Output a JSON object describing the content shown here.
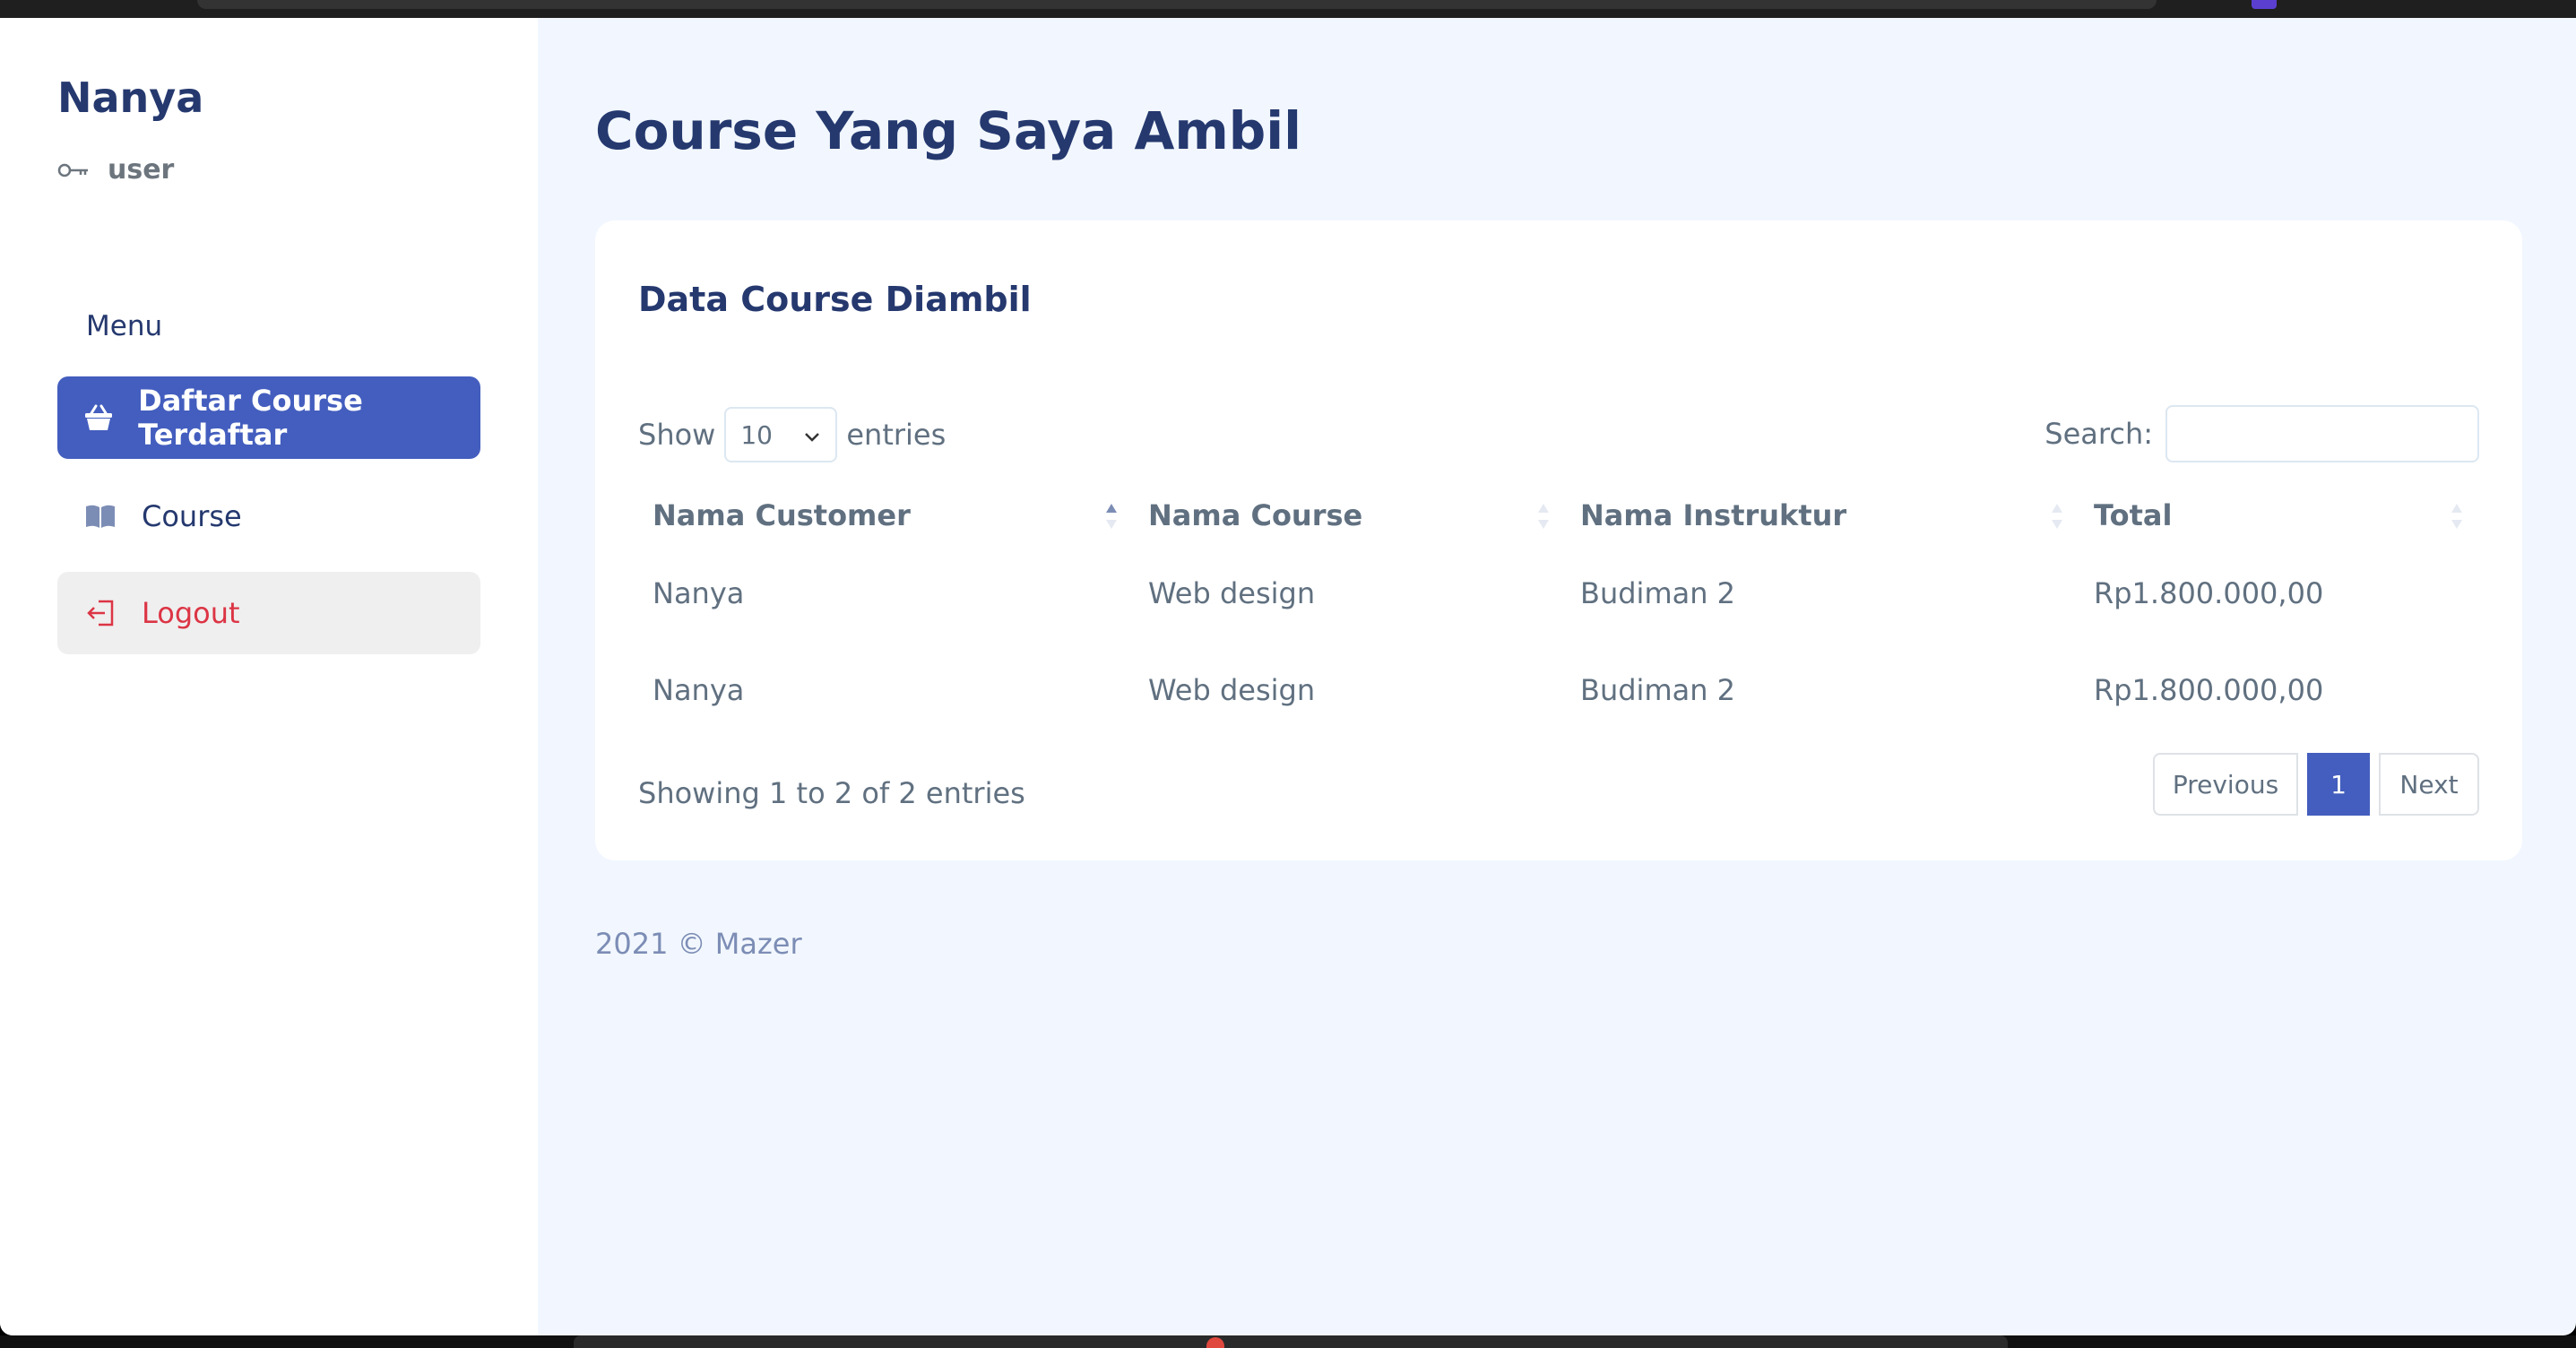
{
  "sidebar": {
    "brand": "Nanya",
    "role": "user",
    "role_icon": "key-icon",
    "menu_title": "Menu",
    "items": [
      {
        "label": "Daftar Course Terdaftar",
        "icon": "basket-icon",
        "active": true
      },
      {
        "label": "Course",
        "icon": "book-icon",
        "active": false
      },
      {
        "label": "Logout",
        "icon": "logout-icon",
        "active": false
      }
    ]
  },
  "page": {
    "title": "Course Yang Saya Ambil"
  },
  "card": {
    "title": "Data Course Diambil",
    "length_prefix": "Show",
    "length_value": "10",
    "length_suffix": "entries",
    "search_label": "Search:",
    "search_value": "",
    "columns": [
      "Nama Customer",
      "Nama Course",
      "Nama Instruktur",
      "Total"
    ],
    "rows": [
      [
        "Nanya",
        "Web design",
        "Budiman 2",
        "Rp1.800.000,00"
      ],
      [
        "Nanya",
        "Web design",
        "Budiman 2",
        "Rp1.800.000,00"
      ]
    ],
    "info": "Showing 1 to 2 of 2 entries",
    "pagination": {
      "previous": "Previous",
      "current": "1",
      "next": "Next"
    }
  },
  "footer": "2021 © Mazer",
  "colors": {
    "primary": "#435ebe",
    "heading": "#25396f",
    "danger": "#dc3545",
    "background": "#f2f7ff"
  }
}
